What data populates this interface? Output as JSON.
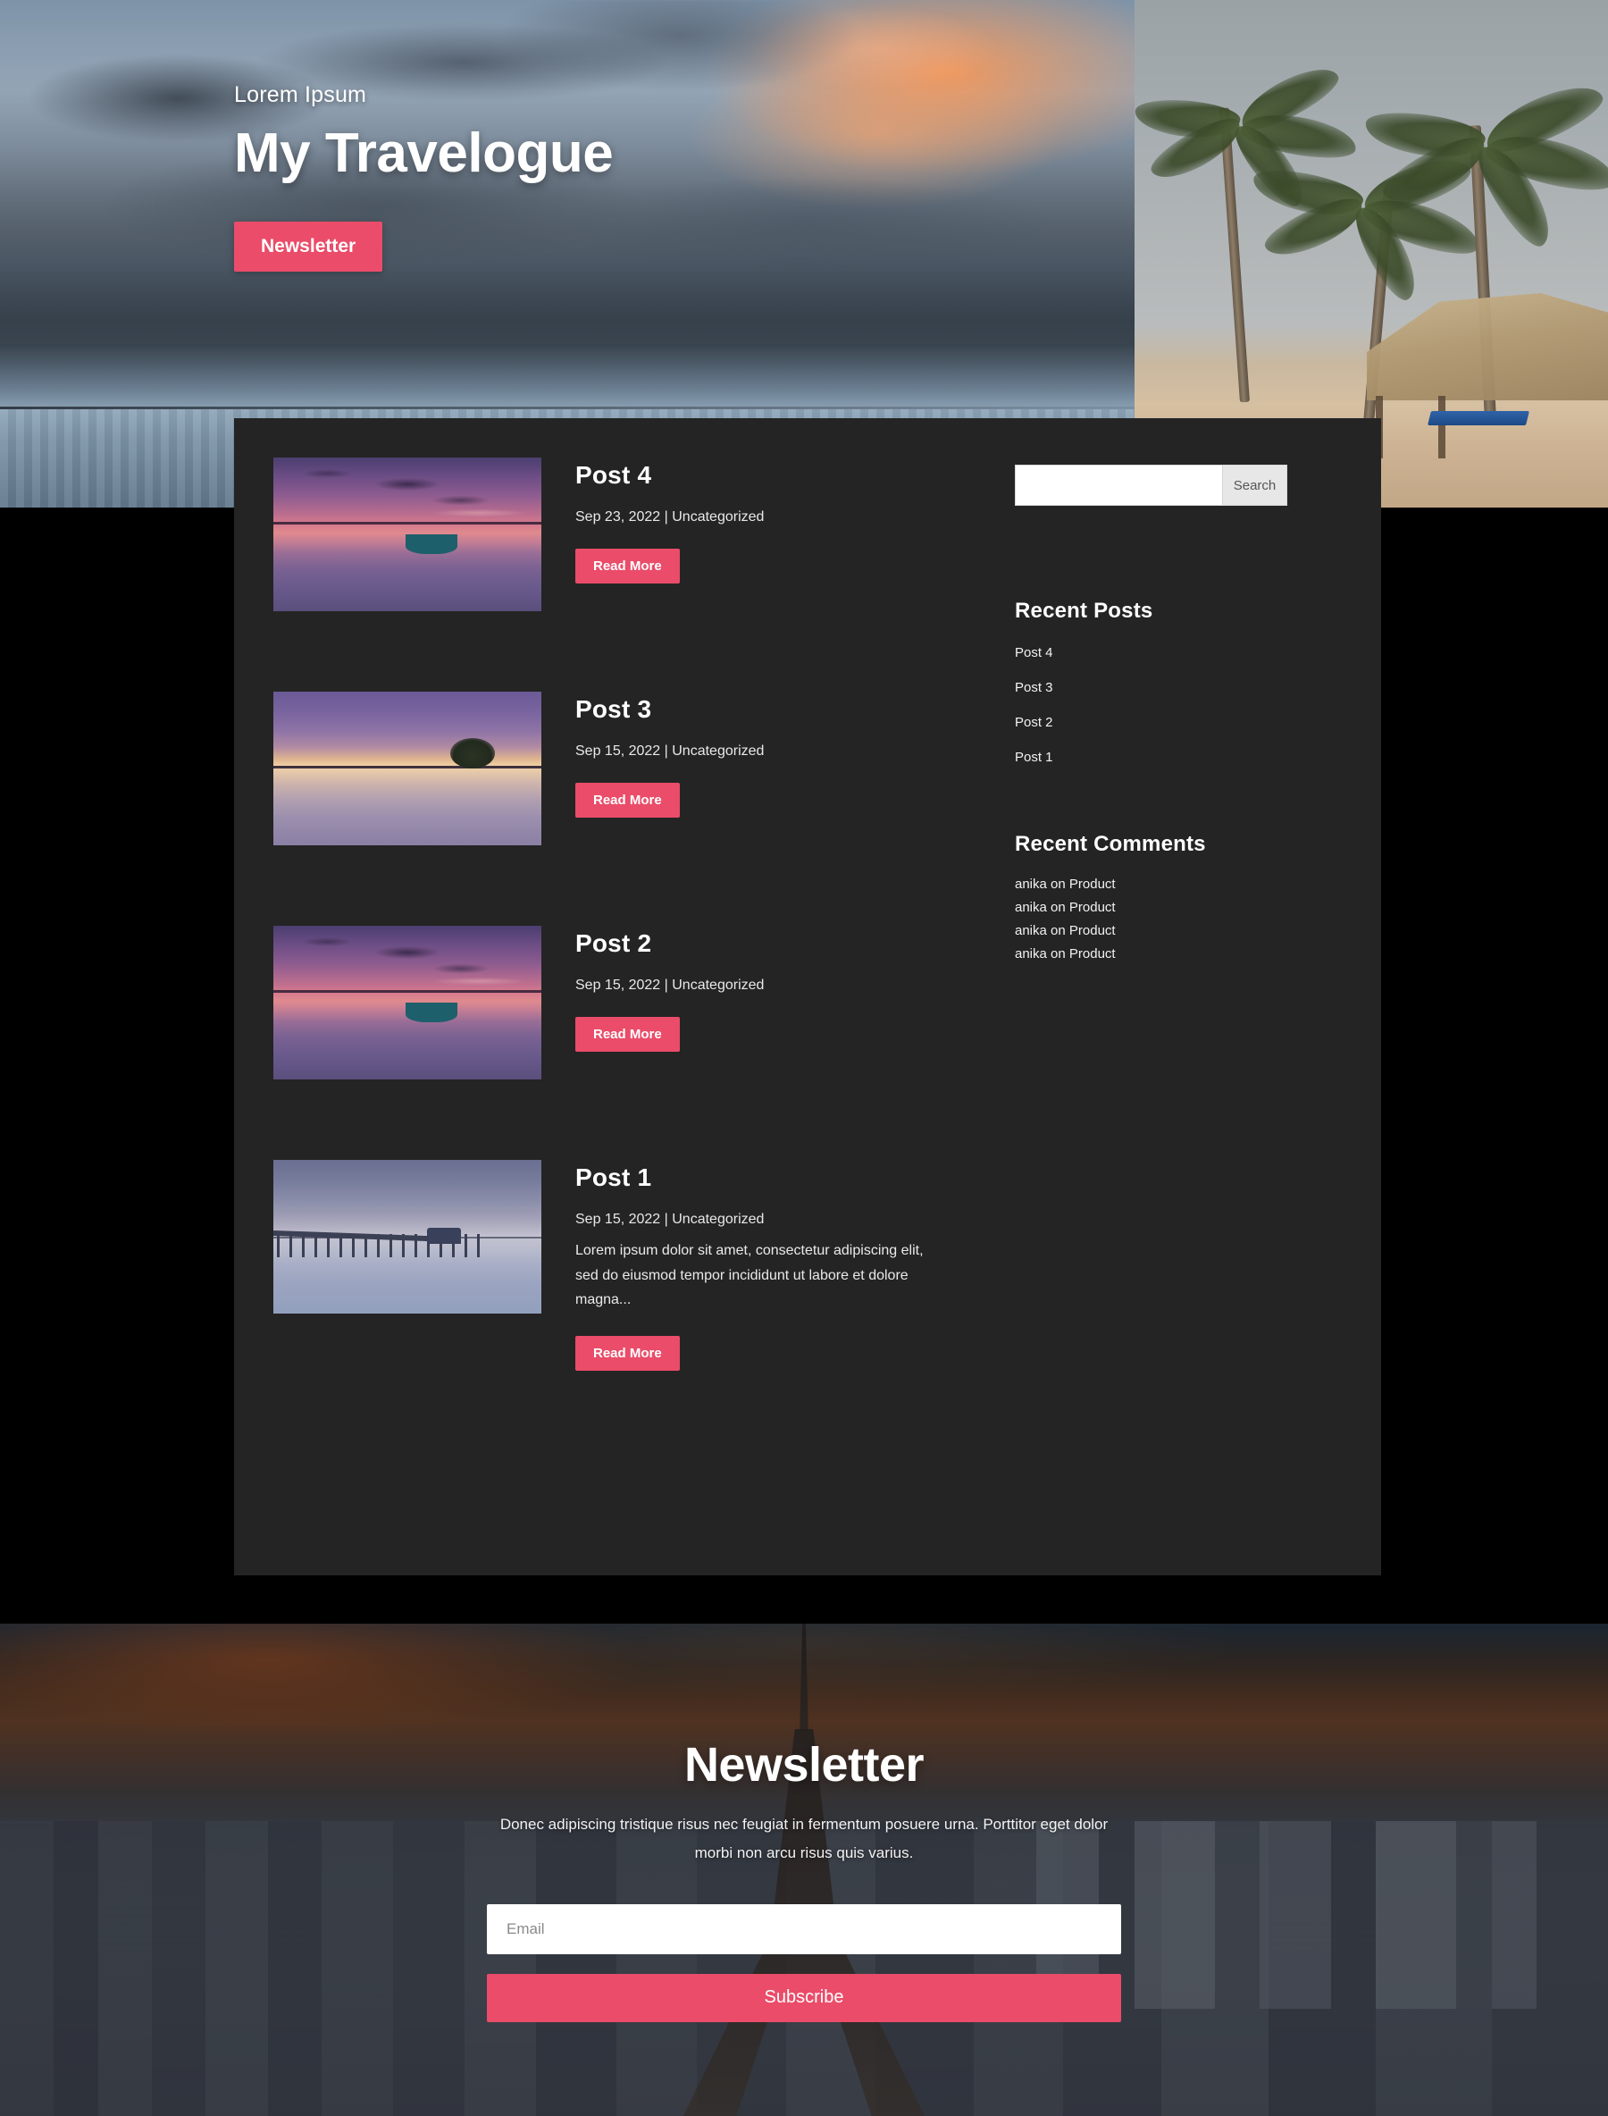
{
  "hero": {
    "subtitle": "Lorem Ipsum",
    "title": "My Travelogue",
    "cta_label": "Newsletter",
    "image_alt": "tropical-beach-with-palm-trees-and-storm-clouds"
  },
  "posts": [
    {
      "title": "Post 4",
      "meta": "Sep 23, 2022 | Uncategorized",
      "excerpt": "",
      "read_more_label": "Read More",
      "thumb_alt": "boat-on-calm-water-at-pink-sunset"
    },
    {
      "title": "Post 3",
      "meta": "Sep 15, 2022 | Uncategorized",
      "excerpt": "",
      "read_more_label": "Read More",
      "thumb_alt": "lone-tree-silhouette-in-still-water-at-dusk"
    },
    {
      "title": "Post 2",
      "meta": "Sep 15, 2022 | Uncategorized",
      "excerpt": "",
      "read_more_label": "Read More",
      "thumb_alt": "boat-on-calm-water-at-pink-sunset"
    },
    {
      "title": "Post 1",
      "meta": "Sep 15, 2022 | Uncategorized",
      "excerpt": "Lorem ipsum dolor sit amet, consectetur adipiscing elit, sed do eiusmod tempor incididunt ut labore et dolore magna...",
      "read_more_label": "Read More",
      "thumb_alt": "wooden-pier-at-blue-hour"
    }
  ],
  "sidebar": {
    "search": {
      "value": "",
      "placeholder": "",
      "button_label": "Search"
    },
    "recent_posts": {
      "title": "Recent Posts",
      "items": [
        "Post 4",
        "Post 3",
        "Post 2",
        "Post 1"
      ]
    },
    "recent_comments": {
      "title": "Recent Comments",
      "items": [
        "anika on Product",
        "anika on Product",
        "anika on Product",
        "anika on Product"
      ]
    }
  },
  "footer": {
    "title": "Newsletter",
    "description": "Donec adipiscing tristique risus nec feugiat in fermentum posuere urna. Porttitor eget dolor morbi non arcu risus quis varius.",
    "email_placeholder": "Email",
    "email_value": "",
    "subscribe_label": "Subscribe",
    "image_alt": "paris-skyline-with-eiffel-tower-at-dusk"
  },
  "colors": {
    "accent": "#ea4c69",
    "card_background": "#242424",
    "page_background": "#000000",
    "text_light": "#ffffff",
    "search_button": "#e7e7e7"
  }
}
